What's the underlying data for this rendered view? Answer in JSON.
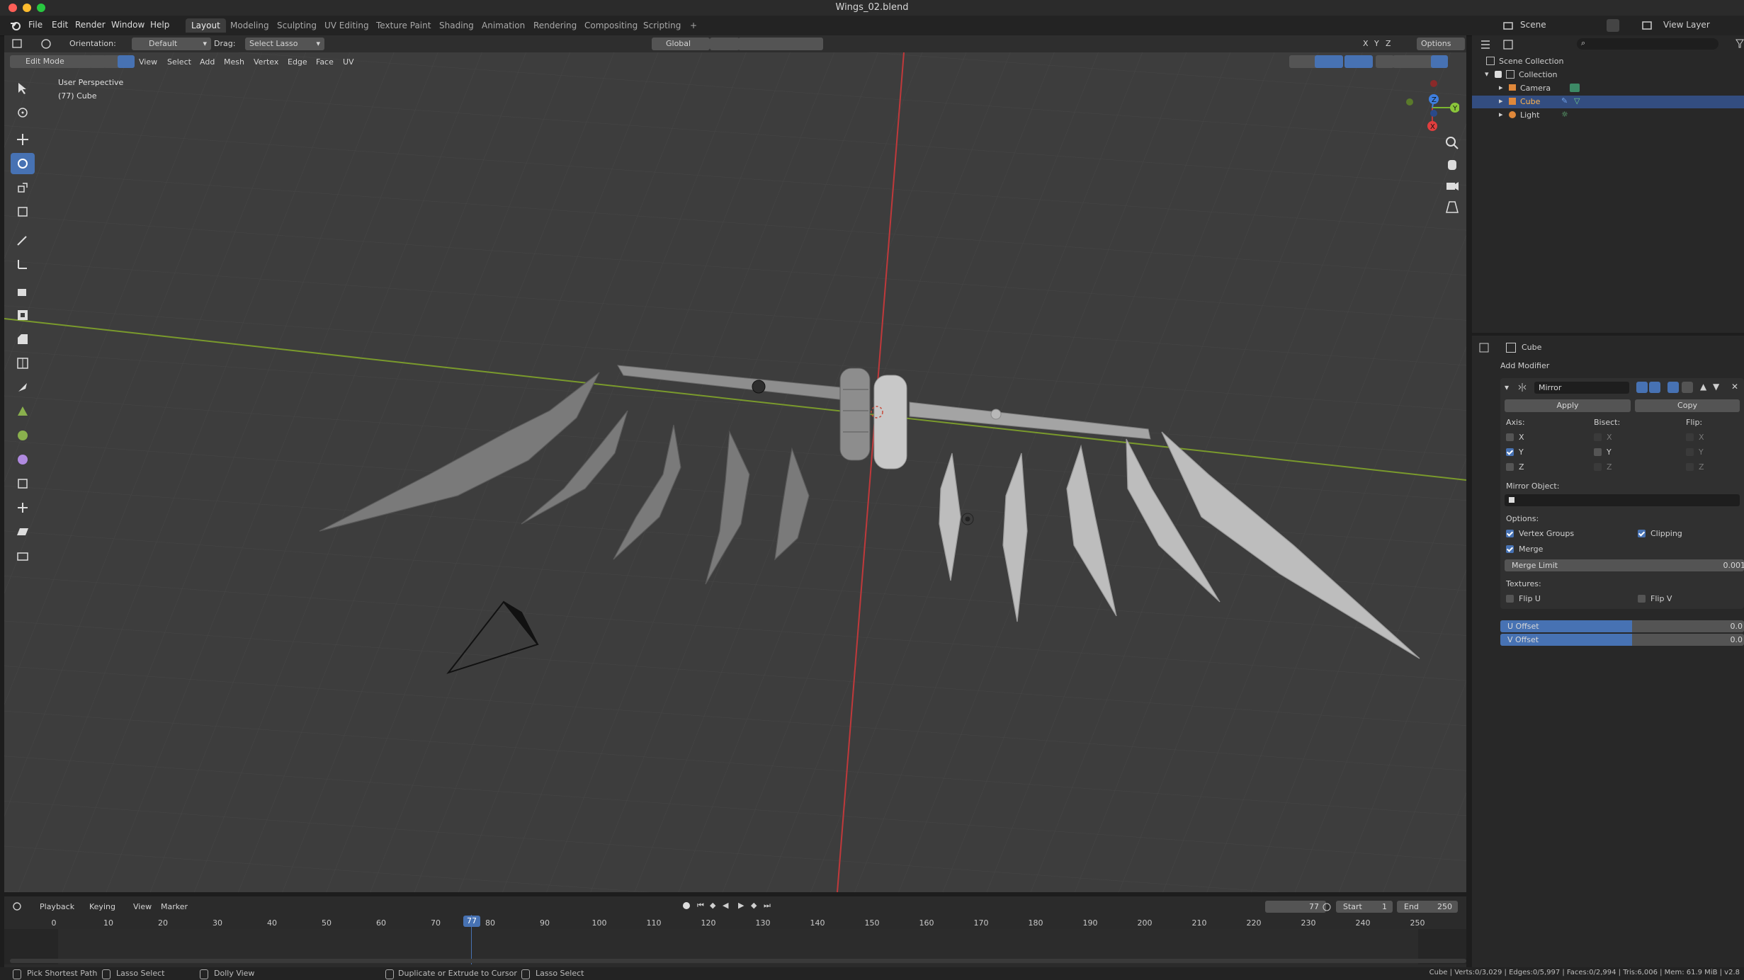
{
  "window": {
    "title": "Wings_02.blend"
  },
  "menu": {
    "file": "File",
    "edit": "Edit",
    "render": "Render",
    "window": "Window",
    "help": "Help"
  },
  "workspaces": [
    "Layout",
    "Modeling",
    "Sculpting",
    "UV Editing",
    "Texture Paint",
    "Shading",
    "Animation",
    "Rendering",
    "Compositing",
    "Scripting"
  ],
  "header": {
    "orientation_label": "Orientation:",
    "orientation_value": "Default",
    "drag_label": "Drag:",
    "drag_value": "Select Lasso",
    "transform_space": "Global",
    "options": "Options",
    "axis_x": "X",
    "axis_y": "Y",
    "axis_z": "Z"
  },
  "editmode": {
    "mode": "Edit Mode",
    "menus": [
      "View",
      "Select",
      "Add",
      "Mesh",
      "Vertex",
      "Edge",
      "Face",
      "UV"
    ]
  },
  "viewport": {
    "view_name": "User Perspective",
    "object_info": "(77) Cube"
  },
  "topright": {
    "scene_label": "Scene",
    "viewlayer_label": "View Layer"
  },
  "outliner": {
    "root": "Scene Collection",
    "collection": "Collection",
    "items": [
      "Camera",
      "Cube",
      "Light"
    ]
  },
  "properties": {
    "object_name": "Cube",
    "add_modifier": "Add Modifier",
    "modifier_name": "Mirror",
    "apply": "Apply",
    "copy": "Copy",
    "axis_label": "Axis:",
    "bisect_label": "Bisect:",
    "flip_label": "Flip:",
    "x": "X",
    "y": "Y",
    "z": "Z",
    "axis_state": {
      "x": false,
      "y": true,
      "z": false
    },
    "mirror_object_label": "Mirror Object:",
    "options_label": "Options:",
    "vertex_groups": "Vertex Groups",
    "vertex_groups_on": true,
    "clipping": "Clipping",
    "clipping_on": true,
    "merge": "Merge",
    "merge_on": true,
    "merge_limit_label": "Merge Limit",
    "merge_limit_value": "0.001",
    "textures_label": "Textures:",
    "flip_u": "Flip U",
    "flip_v": "Flip V",
    "u_offset_label": "U Offset",
    "u_offset_value": "0.0",
    "v_offset_label": "V Offset",
    "v_offset_value": "0.0"
  },
  "timeline": {
    "menus": [
      "Playback",
      "Keying",
      "View",
      "Marker"
    ],
    "current_frame": "77",
    "start_label": "Start",
    "start_value": "1",
    "end_label": "End",
    "end_value": "250",
    "ticks": [
      "0",
      "10",
      "20",
      "30",
      "40",
      "50",
      "60",
      "70",
      "80",
      "90",
      "100",
      "110",
      "120",
      "130",
      "140",
      "150",
      "160",
      "170",
      "180",
      "190",
      "200",
      "210",
      "220",
      "230",
      "240",
      "250"
    ]
  },
  "status": {
    "hint1": "Pick Shortest Path",
    "hint2": "Lasso Select",
    "hint3": "Dolly View",
    "hint4": "Duplicate or Extrude to Cursor",
    "hint5": "Lasso Select",
    "stats": "Cube | Verts:0/3,029 | Edges:0/5,997 | Faces:0/2,994 | Tris:6,006 | Mem: 61.9 MiB | v2.8"
  },
  "colors": {
    "accent": "#4772b3",
    "selected_row": "#334d80",
    "x_axis": "#e03e3e",
    "y_axis": "#7ab530",
    "z_axis": "#3e7fe0"
  }
}
